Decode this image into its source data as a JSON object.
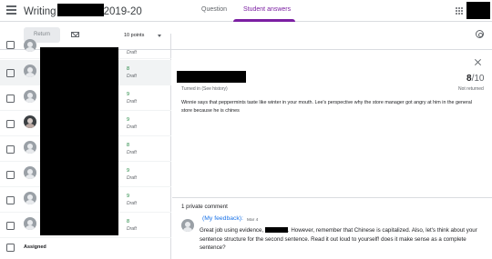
{
  "header": {
    "title_prefix": "Writing",
    "title_suffix": "2019-20",
    "tabs": [
      {
        "label": "Question",
        "active": false
      },
      {
        "label": "Student answers",
        "active": true
      }
    ]
  },
  "toolbar": {
    "return_label": "Return",
    "points_label": "10 points"
  },
  "students": [
    {
      "grade": "",
      "status": "Draft",
      "avatar": "default"
    },
    {
      "grade": "8",
      "status": "Draft",
      "avatar": "default",
      "selected": true
    },
    {
      "grade": "9",
      "status": "Draft",
      "avatar": "default"
    },
    {
      "grade": "9",
      "status": "Draft",
      "avatar": "photo"
    },
    {
      "grade": "8",
      "status": "Draft",
      "avatar": "default"
    },
    {
      "grade": "9",
      "status": "Draft",
      "avatar": "default"
    },
    {
      "grade": "9",
      "status": "Draft",
      "avatar": "default"
    },
    {
      "grade": "8",
      "status": "Draft",
      "avatar": "default"
    }
  ],
  "assigned_label": "Assigned",
  "panel": {
    "score": "8",
    "score_total": "/10",
    "turned_in": "Turned in (See history)",
    "return_status": "Not returned",
    "answer": "Winnie says that peppermints taste like winter in your mouth. Lee's perspective why the store manager got angry at him in the general store because he is chines",
    "comment_count": "1 private comment",
    "comment": {
      "author": "(My feedback):",
      "date": "Mar 4",
      "text_before": "Great job using evidence, ",
      "text_after": ". However, remember that Chinese is capitalized. Also, let's think about your sentence structure for the second sentence. Read it out loud to yourself! does it make sense as a complete sentence?"
    }
  },
  "colors": {
    "accent": "#7b1fa2",
    "grade_green": "#188038",
    "link_blue": "#1a73e8"
  },
  "icons": [
    "menu-icon",
    "mail-icon",
    "chevron-down-icon",
    "settings-icon",
    "apps-icon",
    "close-icon",
    "avatar-icon"
  ]
}
